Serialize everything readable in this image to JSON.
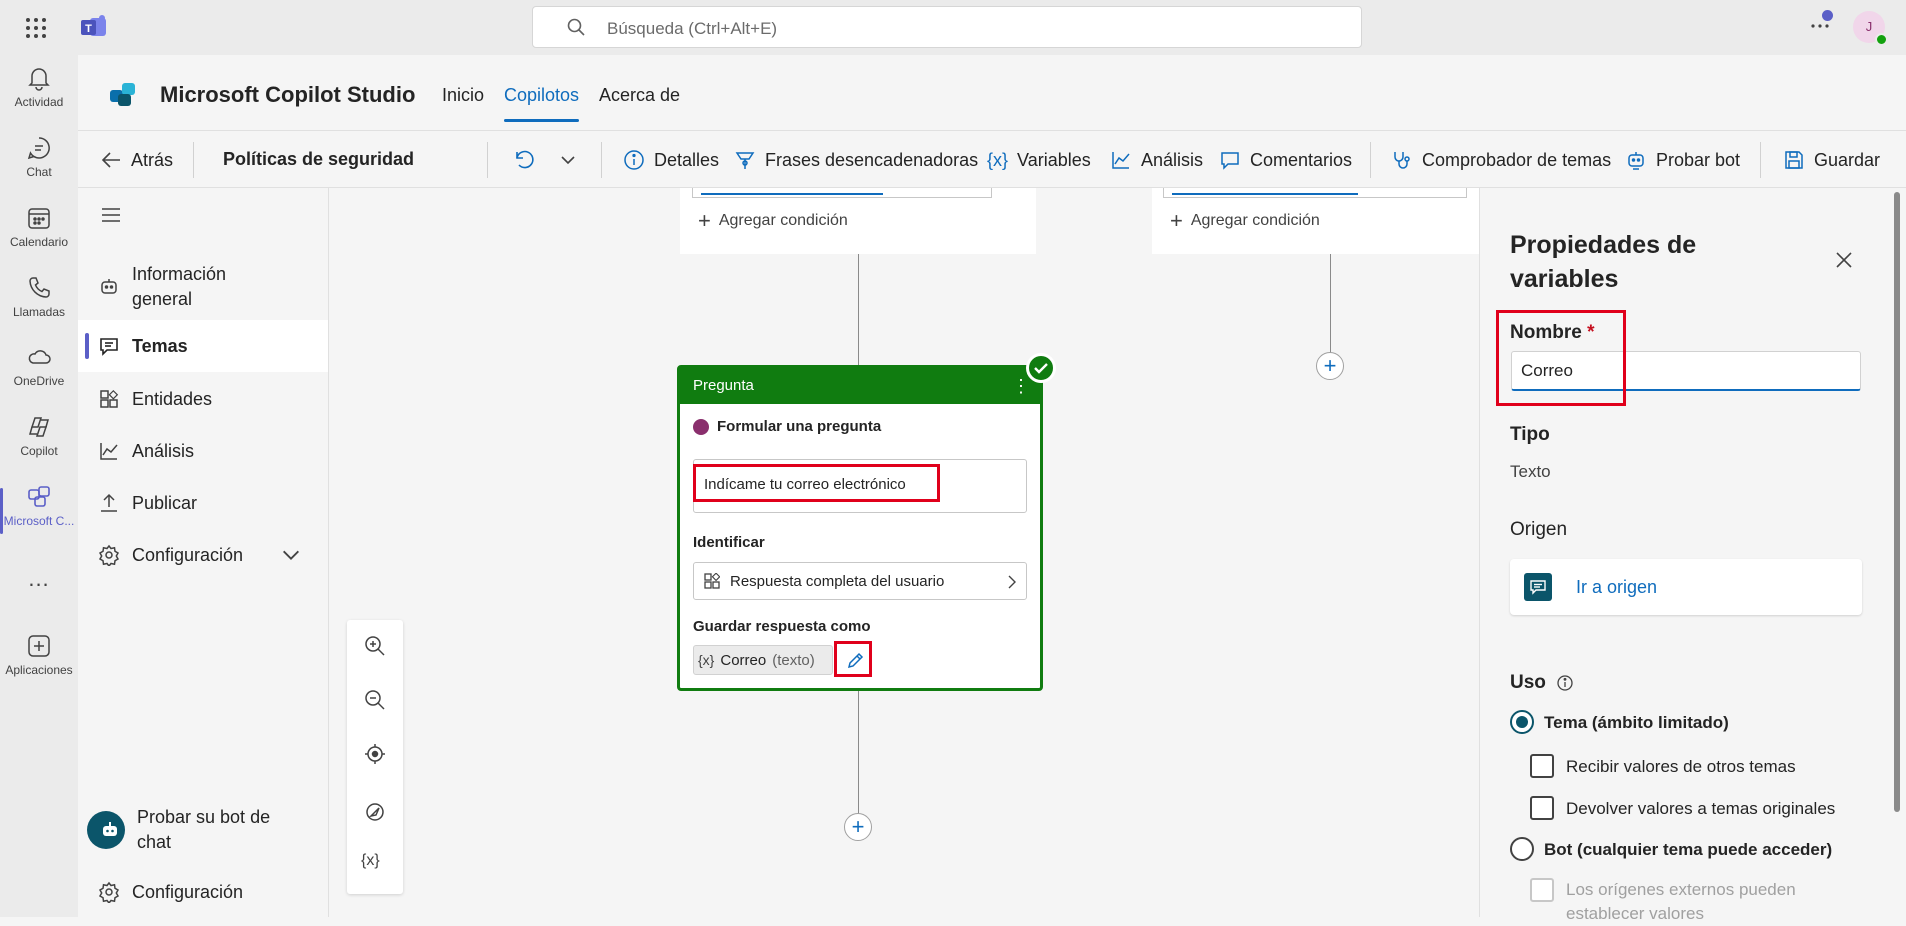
{
  "teams": {
    "search_placeholder": "Búsqueda (Ctrl+Alt+E)",
    "avatar_initial": "J",
    "rail": [
      {
        "label": "Actividad"
      },
      {
        "label": "Chat"
      },
      {
        "label": "Calendario"
      },
      {
        "label": "Llamadas"
      },
      {
        "label": "OneDrive"
      },
      {
        "label": "Copilot"
      },
      {
        "label": "Microsoft C..."
      },
      {
        "label": "Aplicaciones"
      }
    ],
    "more_label": "..."
  },
  "app": {
    "title": "Microsoft Copilot Studio",
    "tabs": [
      "Inicio",
      "Copilotos",
      "Acerca de"
    ],
    "active_tab": "Copilotos"
  },
  "toolbar": {
    "back": "Atrás",
    "topic_title": "Políticas de seguridad",
    "details": "Detalles",
    "triggers": "Frases desencadenadoras",
    "variables": "Variables",
    "analytics": "Análisis",
    "comments": "Comentarios",
    "checker": "Comprobador de temas",
    "test": "Probar bot",
    "save": "Guardar"
  },
  "leftnav": {
    "items": [
      {
        "label": "Información general"
      },
      {
        "label": "Temas"
      },
      {
        "label": "Entidades"
      },
      {
        "label": "Análisis"
      },
      {
        "label": "Publicar"
      },
      {
        "label": "Configuración"
      }
    ],
    "test_bot": "Probar su bot de chat",
    "settings": "Configuración"
  },
  "canvas": {
    "add_condition": "Agregar condición",
    "question_node": {
      "header": "Pregunta",
      "ask_label": "Formular una pregunta",
      "question_text": "Indícame tu correo electrónico",
      "identify_label": "Identificar",
      "identify_value": "Respuesta completa del usuario",
      "save_label": "Guardar respuesta como",
      "variable_name": "Correo",
      "variable_type": "(texto)",
      "var_prefix": "{x}"
    },
    "zoom_var_label": "{x}"
  },
  "panel": {
    "title": "Propiedades de variables",
    "name_label": "Nombre",
    "required_mark": "*",
    "name_value": "Correo",
    "type_label": "Tipo",
    "type_value": "Texto",
    "origin_label": "Origen",
    "origin_link": "Ir a origen",
    "usage_label": "Uso",
    "scope_topic": "Tema (ámbito limitado)",
    "receive_values": "Recibir valores de otros temas",
    "return_values": "Devolver valores a temas originales",
    "scope_bot": "Bot (cualquier tema puede acceder)",
    "external_sources": "Los orígenes externos pueden establecer valores"
  },
  "colors": {
    "accent": "#0f6cbd",
    "teams_purple": "#5b5fc7",
    "node_green": "#107c10",
    "highlight_red": "#e0001b"
  }
}
